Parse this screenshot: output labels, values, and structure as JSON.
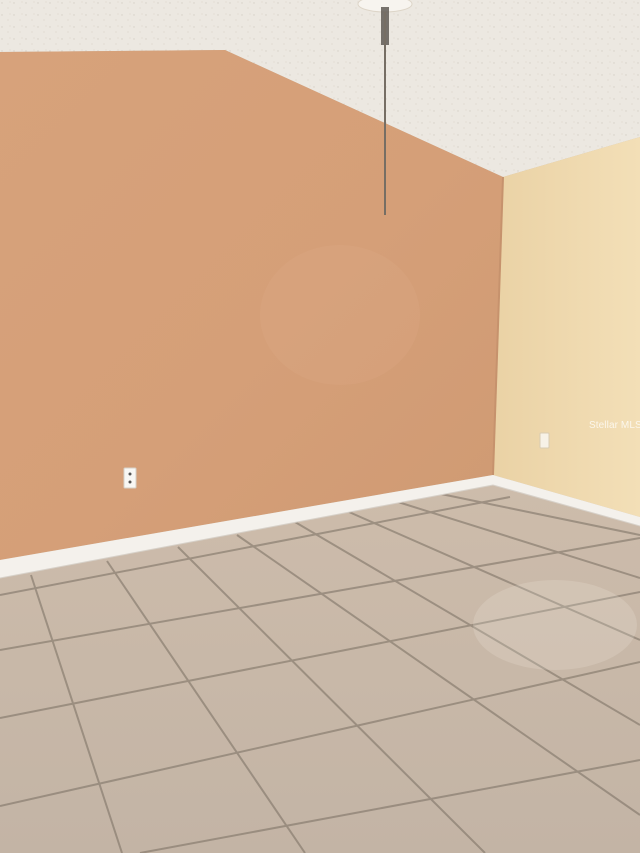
{
  "photo": {
    "watermark": "Stellar MLS",
    "colors": {
      "ceiling": "#ece8e1",
      "accent_wall": "#d7a179",
      "side_wall": "#efd9ae",
      "baseboard": "#f4f1ec",
      "floor_tile": "#c7b8a8",
      "grout": "#7f7467"
    },
    "objects": [
      "textured-ceiling",
      "ceiling-fan",
      "fan-pull-chain",
      "accent-wall",
      "side-wall",
      "baseboard",
      "wall-outlet",
      "tile-floor"
    ]
  }
}
